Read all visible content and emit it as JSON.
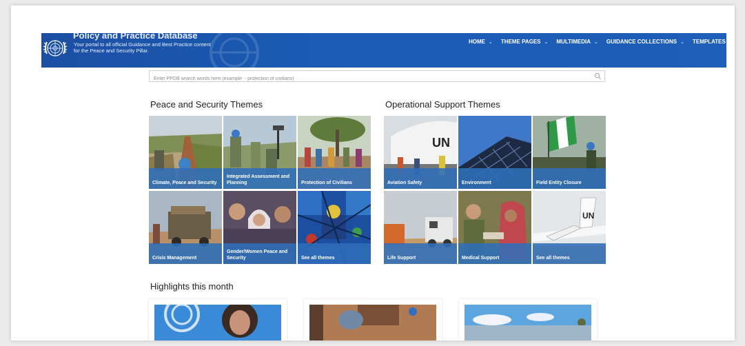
{
  "header": {
    "title": "Policy and Practice Database",
    "subtitle": "Your portal to all official Guidance and Best Practice content for the Peace and Security Pillar.",
    "nav": [
      {
        "label": "HOME"
      },
      {
        "label": "THEME PAGES"
      },
      {
        "label": "MULTIMEDIA"
      },
      {
        "label": "GUIDANCE COLLECTIONS"
      },
      {
        "label": "TEMPLATES AND M"
      }
    ]
  },
  "search": {
    "placeholder": "Enter PPDB search words here (example  - protection of civilians)",
    "icon": "search-icon"
  },
  "peace_security": {
    "title": "Peace and Security Themes",
    "tiles": [
      {
        "label": "Climate, Peace and Security"
      },
      {
        "label": "Integrated Assessment and Planning"
      },
      {
        "label": "Protection of Civilians"
      },
      {
        "label": "Crisis Management"
      },
      {
        "label": "Gender/Women Peace and Security"
      },
      {
        "label": "See all themes"
      }
    ]
  },
  "operational": {
    "title": "Operational Support Themes",
    "tiles": [
      {
        "label": "Aviation Safety"
      },
      {
        "label": "Environment"
      },
      {
        "label": "Field Entity Closure"
      },
      {
        "label": "Life Support"
      },
      {
        "label": "Medical Support"
      },
      {
        "label": "See all themes"
      }
    ]
  },
  "highlights": {
    "title": "Highlights this month"
  },
  "colors": {
    "header_blue": "#1c4fa3",
    "caption_blue": "#2f6eba"
  }
}
